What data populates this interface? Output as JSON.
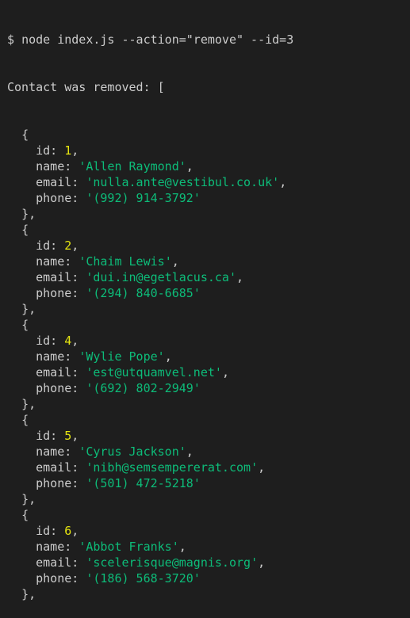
{
  "terminal": {
    "prompt": "$",
    "command": "node index.js --action=\"remove\" --id=3",
    "result_header": "Contact was removed: [",
    "open_brace": "{",
    "close_brace": "},",
    "labels": {
      "id": "id:",
      "name": "name:",
      "email": "email:",
      "phone": "phone:"
    },
    "contacts": [
      {
        "id": "1",
        "name": "Allen Raymond",
        "email": "nulla.ante@vestibul.co.uk",
        "phone": "(992) 914-3792"
      },
      {
        "id": "2",
        "name": "Chaim Lewis",
        "email": "dui.in@egetlacus.ca",
        "phone": "(294) 840-6685"
      },
      {
        "id": "4",
        "name": "Wylie Pope",
        "email": "est@utquamvel.net",
        "phone": "(692) 802-2949"
      },
      {
        "id": "5",
        "name": "Cyrus Jackson",
        "email": "nibh@semsempererat.com",
        "phone": "(501) 472-5218"
      },
      {
        "id": "6",
        "name": "Abbot Franks",
        "email": "scelerisque@magnis.org",
        "phone": "(186) 568-3720"
      }
    ]
  },
  "colors": {
    "background": "#1e1e1e",
    "text": "#cccccc",
    "number": "#e5e510",
    "string": "#0dbc79"
  }
}
